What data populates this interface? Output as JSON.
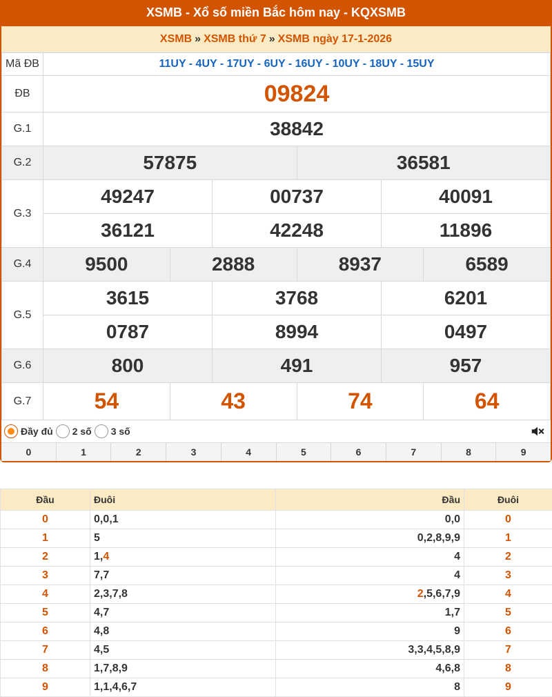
{
  "title": "XSMB - Xổ số miền Bắc hôm nay - KQXSMB",
  "breadcrumb": {
    "a": "XSMB",
    "b": "XSMB thứ 7",
    "c": "XSMB ngày 17-1-2026",
    "sep": "»"
  },
  "labels": {
    "madb": "Mã ĐB",
    "db": "ĐB",
    "g1": "G.1",
    "g2": "G.2",
    "g3": "G.3",
    "g4": "G.4",
    "g5": "G.5",
    "g6": "G.6",
    "g7": "G.7"
  },
  "madb": "11UY - 4UY - 17UY - 6UY - 16UY - 10UY - 18UY - 15UY",
  "db": "09824",
  "g1": "38842",
  "g2": [
    "57875",
    "36581"
  ],
  "g3": [
    "49247",
    "00737",
    "40091",
    "36121",
    "42248",
    "11896"
  ],
  "g4": [
    "9500",
    "2888",
    "8937",
    "6589"
  ],
  "g5": [
    "3615",
    "3768",
    "6201",
    "0787",
    "8994",
    "0497"
  ],
  "g6": [
    "800",
    "491",
    "957"
  ],
  "g7": [
    "54",
    "43",
    "74",
    "64"
  ],
  "options": {
    "full": "Đầy đủ",
    "two": "2 số",
    "three": "3 số",
    "selected": "full"
  },
  "digits": [
    "0",
    "1",
    "2",
    "3",
    "4",
    "5",
    "6",
    "7",
    "8",
    "9"
  ],
  "loto_headers": {
    "dau": "Đầu",
    "duoi": "Đuôi",
    "dau2": "Đầu",
    "duoi2": "Đuôi"
  },
  "loto_rows": [
    {
      "d": "0",
      "tails": "0,0,1",
      "heads": "0,0",
      "t": "0"
    },
    {
      "d": "1",
      "tails": "5",
      "heads": "0,2,8,9,9",
      "t": "1"
    },
    {
      "d": "2",
      "tails_a": "1,",
      "tails_b": "4",
      "heads": "4",
      "t": "2"
    },
    {
      "d": "3",
      "tails": "7,7",
      "heads": "4",
      "t": "3"
    },
    {
      "d": "4",
      "tails": "2,3,7,8",
      "heads_a": "2",
      "heads_b": ",5,6,7,9",
      "t": "4"
    },
    {
      "d": "5",
      "tails": "4,7",
      "heads": "1,7",
      "t": "5"
    },
    {
      "d": "6",
      "tails": "4,8",
      "heads": "9",
      "t": "6"
    },
    {
      "d": "7",
      "tails": "4,5",
      "heads": "3,3,4,5,8,9",
      "t": "7"
    },
    {
      "d": "8",
      "tails": "1,7,8,9",
      "heads": "4,6,8",
      "t": "8"
    },
    {
      "d": "9",
      "tails": "1,1,4,6,7",
      "heads": "8",
      "t": "9"
    }
  ],
  "colors": {
    "accent": "#d35400",
    "header_bg": "#faebc4",
    "link_blue": "#1565c0"
  }
}
